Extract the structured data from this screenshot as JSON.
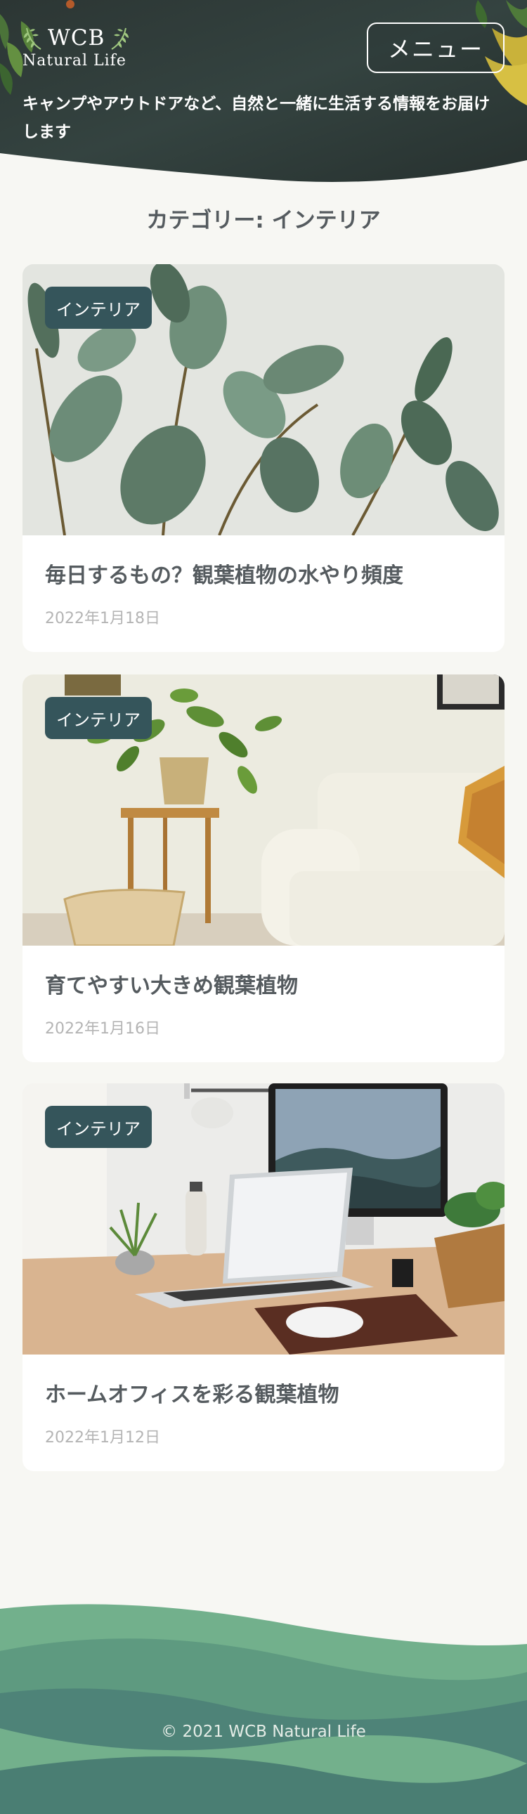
{
  "header": {
    "logo_title": "WCB",
    "logo_subtitle": "Natural Life",
    "menu_label": "メニュー",
    "tagline": "キャンプやアウトドアなど、自然と一緒に生活する情報をお届けします"
  },
  "category_title": "カテゴリー: インテリア",
  "posts": [
    {
      "badge": "インテリア",
      "title": "毎日するもの？観葉植物の水やり頻度",
      "date": "2022年1月18日"
    },
    {
      "badge": "インテリア",
      "title": "育てやすい大きめ観葉植物",
      "date": "2022年1月16日"
    },
    {
      "badge": "インテリア",
      "title": "ホームオフィスを彩る観葉植物",
      "date": "2022年1月12日"
    }
  ],
  "footer": {
    "copyright": "© 2021 WCB Natural Life"
  },
  "colors": {
    "header_bg": "#2e3b3a",
    "badge_bg": "#35555b",
    "page_bg": "#f7f7f3",
    "footer_wave_light": "#6fae8a",
    "footer_wave_dark": "#4a7e73"
  }
}
